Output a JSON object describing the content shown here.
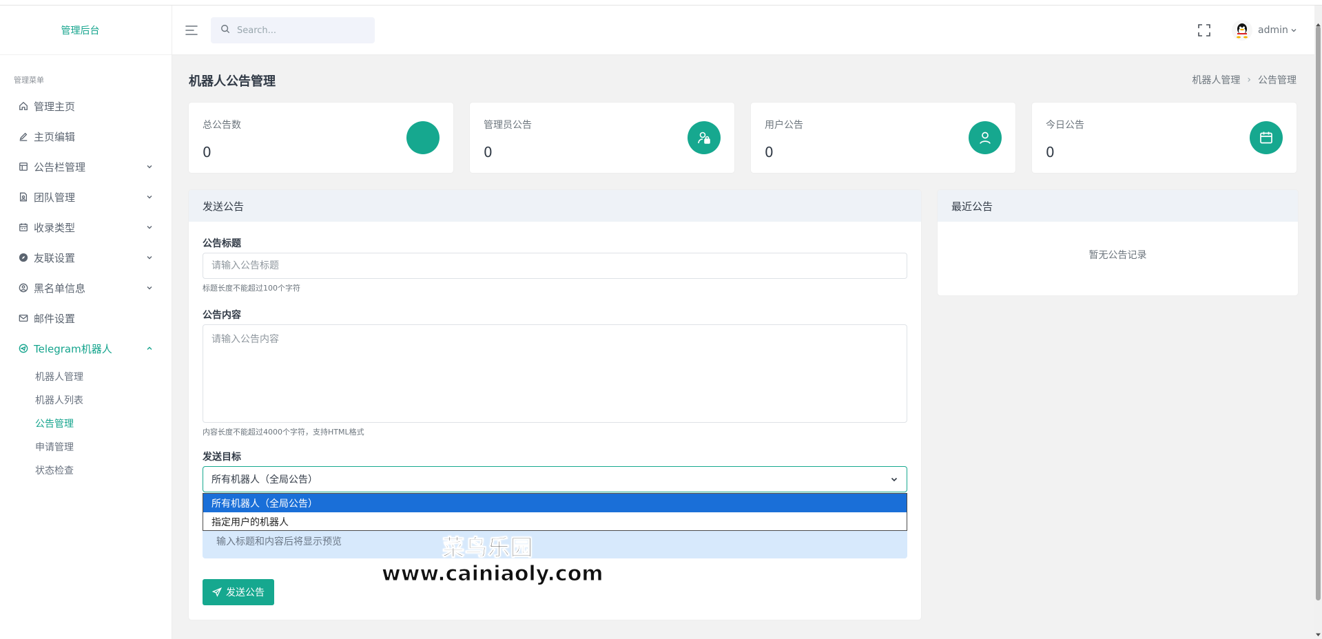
{
  "brand": "管理后台",
  "sidebar": {
    "menu_title": "管理菜单",
    "items": [
      {
        "label": "管理主页",
        "icon": "home-icon"
      },
      {
        "label": "主页编辑",
        "icon": "edit-icon"
      },
      {
        "label": "公告栏管理",
        "icon": "board-icon"
      },
      {
        "label": "团队管理",
        "icon": "team-icon"
      },
      {
        "label": "收录类型",
        "icon": "calendar-icon"
      },
      {
        "label": "友联设置",
        "icon": "compass-icon"
      },
      {
        "label": "黑名单信息",
        "icon": "user-circle-icon"
      },
      {
        "label": "邮件设置",
        "icon": "mail-icon"
      },
      {
        "label": "Telegram机器人",
        "icon": "telegram-icon"
      }
    ],
    "submenu": [
      "机器人管理",
      "机器人列表",
      "公告管理",
      "申请管理",
      "状态检查"
    ]
  },
  "header": {
    "search_placeholder": "Search...",
    "user_name": "admin"
  },
  "page": {
    "title": "机器人公告管理",
    "breadcrumb": [
      "机器人管理",
      "公告管理"
    ]
  },
  "stats": [
    {
      "label": "总公告数",
      "value": "0",
      "icon": "bullhorn-icon"
    },
    {
      "label": "管理员公告",
      "value": "0",
      "icon": "user-lock-icon"
    },
    {
      "label": "用户公告",
      "value": "0",
      "icon": "user-icon"
    },
    {
      "label": "今日公告",
      "value": "0",
      "icon": "calendar-icon"
    }
  ],
  "send_form": {
    "card_title": "发送公告",
    "title_label": "公告标题",
    "title_placeholder": "请输入公告标题",
    "title_help": "标题长度不能超过100个字符",
    "content_label": "公告内容",
    "content_placeholder": "请输入公告内容",
    "content_help": "内容长度不能超过4000个字符，支持HTML格式",
    "target_label": "发送目标",
    "target_selected": "所有机器人（全局公告）",
    "target_options": [
      "所有机器人（全局公告）",
      "指定用户的机器人"
    ],
    "preview_text": "输入标题和内容后将显示预览",
    "submit_label": "发送公告"
  },
  "recent": {
    "card_title": "最近公告",
    "empty_text": "暂无公告记录"
  },
  "watermark": {
    "line1": "菜鸟乐园",
    "line2": "www.cainiaoly.com"
  },
  "colors": {
    "accent": "#16a88f",
    "dropdown_selected": "#1a6fd8",
    "preview_bg": "#d7e9fc"
  }
}
